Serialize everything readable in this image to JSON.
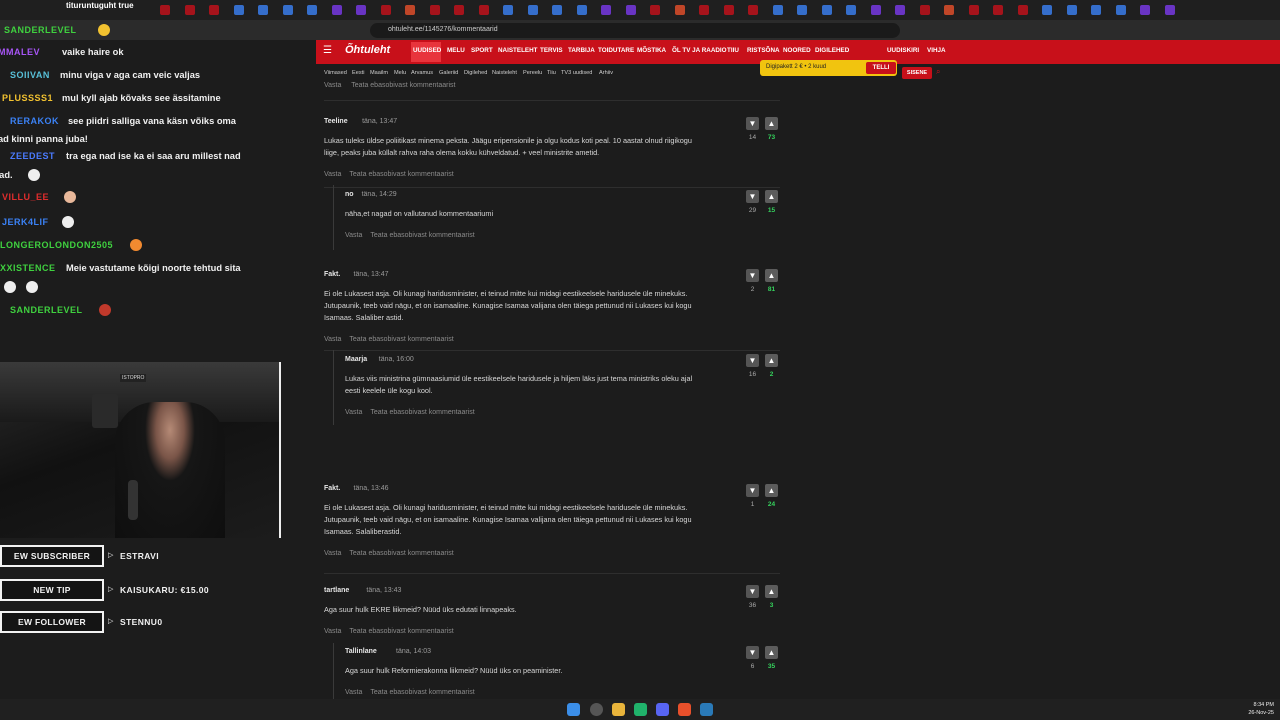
{
  "browser": {
    "url": "ohtuleht.ee/1145276/kommentaarid",
    "title_fragment": "tituruntuguht true"
  },
  "site": {
    "logo": "Õhtuleht",
    "nav": [
      "UUDISED",
      "MELU",
      "SPORT",
      "NAISTELEHT",
      "TERVIS",
      "TARBIJA",
      "TOIDUTARE",
      "MÕSTIKA",
      "ÕL TV JA RAADIO",
      "TIIU",
      "RISTSÕNA",
      "NOORED",
      "DIGILEHED"
    ],
    "nav_right": [
      "UUDISKIRI",
      "VIHJA"
    ],
    "subnav": [
      "Viimased",
      "Eesti",
      "Maailm",
      "Melu",
      "Arvamus",
      "Galeriid",
      "Digilehed",
      "Naisteleht",
      "Pereelu",
      "Tiiu",
      "TV3 uudised",
      "Arhiiv"
    ],
    "promo_text": "Digipakett 2 € • 2 kuud",
    "promo_button": "TELLI",
    "login_button": "SISENE"
  },
  "comment_actions": {
    "reply": "Vasta",
    "report": "Teata ebasobivast kommentaarist"
  },
  "comments": [
    {
      "author": "Teeline",
      "time": "täna, 13:47",
      "text": [
        "Lukas tuleks üldse poliitikast minema peksta. Jäägu eripensionile ja olgu kodus koti peal. 10 aastat olnud riigikogu",
        "liige, peaks juba küllalt rahva raha olema kokku kühveldatud. + veel ministrite ametid."
      ],
      "down": "14",
      "up": "73"
    },
    {
      "author": "no",
      "time": "täna, 14:29",
      "text": [
        "näha,et nagad on vallutanud kommentaariumi"
      ],
      "down": "29",
      "up": "15",
      "reply": true
    },
    {
      "author": "Fakt.",
      "time": "täna, 13:47",
      "text": [
        "Ei ole Lukasest asja. Oli kunagi haridusminister, ei teinud mitte kui midagi eestikeelsele haridusele üle minekuks.",
        "Jutupaunik, teeb vaid nägu, et on isamaaline. Kunagise Isamaa valijana olen täiega pettunud nii Lukases kui kogu",
        "Isamaas. Salaliber astid."
      ],
      "down": "2",
      "up": "81"
    },
    {
      "author": "Maarja",
      "time": "täna, 16:00",
      "text": [
        "Lukas viis ministrina gümnaasiumid üle eestikeelsele haridusele ja hiljem läks just tema ministriks oleku ajal",
        "eesti keelele üle kogu kool."
      ],
      "down": "16",
      "up": "2",
      "reply": true
    },
    {
      "author": "Fakt.",
      "time": "täna, 13:46",
      "text": [
        "Ei ole Lukasest asja. Oli kunagi haridusminister, ei teinud mitte kui midagi eestikeelsele haridusele üle minekuks.",
        "Jutupaunik, teeb vaid nägu, et on isamaaline. Kunagise Isamaa valijana olen täiega pettunud nii Lukases kui kogu",
        "Isamaas. Salaliberastid."
      ],
      "down": "1",
      "up": "24"
    },
    {
      "author": "tartlane",
      "time": "täna, 13:43",
      "text": [
        "Aga suur hulk EKRE liikmeid? Nüüd üks edutati linnapeaks."
      ],
      "down": "36",
      "up": "3"
    },
    {
      "author": "Tallinlane",
      "time": "täna, 14:03",
      "text": [
        "Aga suur hulk Reformierakonna liikmeid? Nüüd üks on peaminister."
      ],
      "down": "6",
      "up": "35",
      "reply": true
    }
  ],
  "chat": [
    {
      "user": "SANDERLEVEL",
      "color": "#3fd13f",
      "msg": ""
    },
    {
      "user": "MMALEV",
      "color": "#a855f7",
      "msg": "vaike haire ok"
    },
    {
      "user": "SOIIVAN",
      "color": "#58c0d8",
      "msg": "minu viga v aga cam veic valjas"
    },
    {
      "user": "PLUSSSS1",
      "color": "#f2c230",
      "msg": "mul kyll ajab kõvaks see ässitamine"
    },
    {
      "user": "RERAKOK",
      "color": "#3b82f6",
      "msg": "see piidri salliga vana käsn võiks oma",
      "msg2": "ad kinni panna juba!"
    },
    {
      "user": "ZEEDEST",
      "color": "#4b7bff",
      "msg": "tra ega nad ise ka ei saa aru millest nad",
      "msg2": "vad."
    },
    {
      "user": "VILLU_EE",
      "color": "#e02d2d",
      "msg": ""
    },
    {
      "user": "JERK4LIF",
      "color": "#3b82f6",
      "msg": ""
    },
    {
      "user": "LONGEROLONDON2505",
      "color": "#3fd13f",
      "msg": ""
    },
    {
      "user": "XXISTENCE",
      "color": "#3fd13f",
      "msg": "Meie vastutame kõigi noorte tehtud sita"
    },
    {
      "user": "SANDERLEVEL",
      "color": "#3fd13f",
      "msg": ""
    }
  ],
  "alerts": [
    {
      "label": "EW SUBSCRIBER",
      "value": "ESTRAVI"
    },
    {
      "label": "NEW TIP",
      "value": "KAISUKARU: €15.00"
    },
    {
      "label": "EW FOLLOWER",
      "value": "STENNU0"
    }
  ],
  "webcam_sign": "ISTOPRO",
  "clock": {
    "time": "8:34 PM",
    "date": "26-Nov-25"
  },
  "colors": {
    "brand": "#c8101a",
    "upvote": "#35d35d"
  }
}
